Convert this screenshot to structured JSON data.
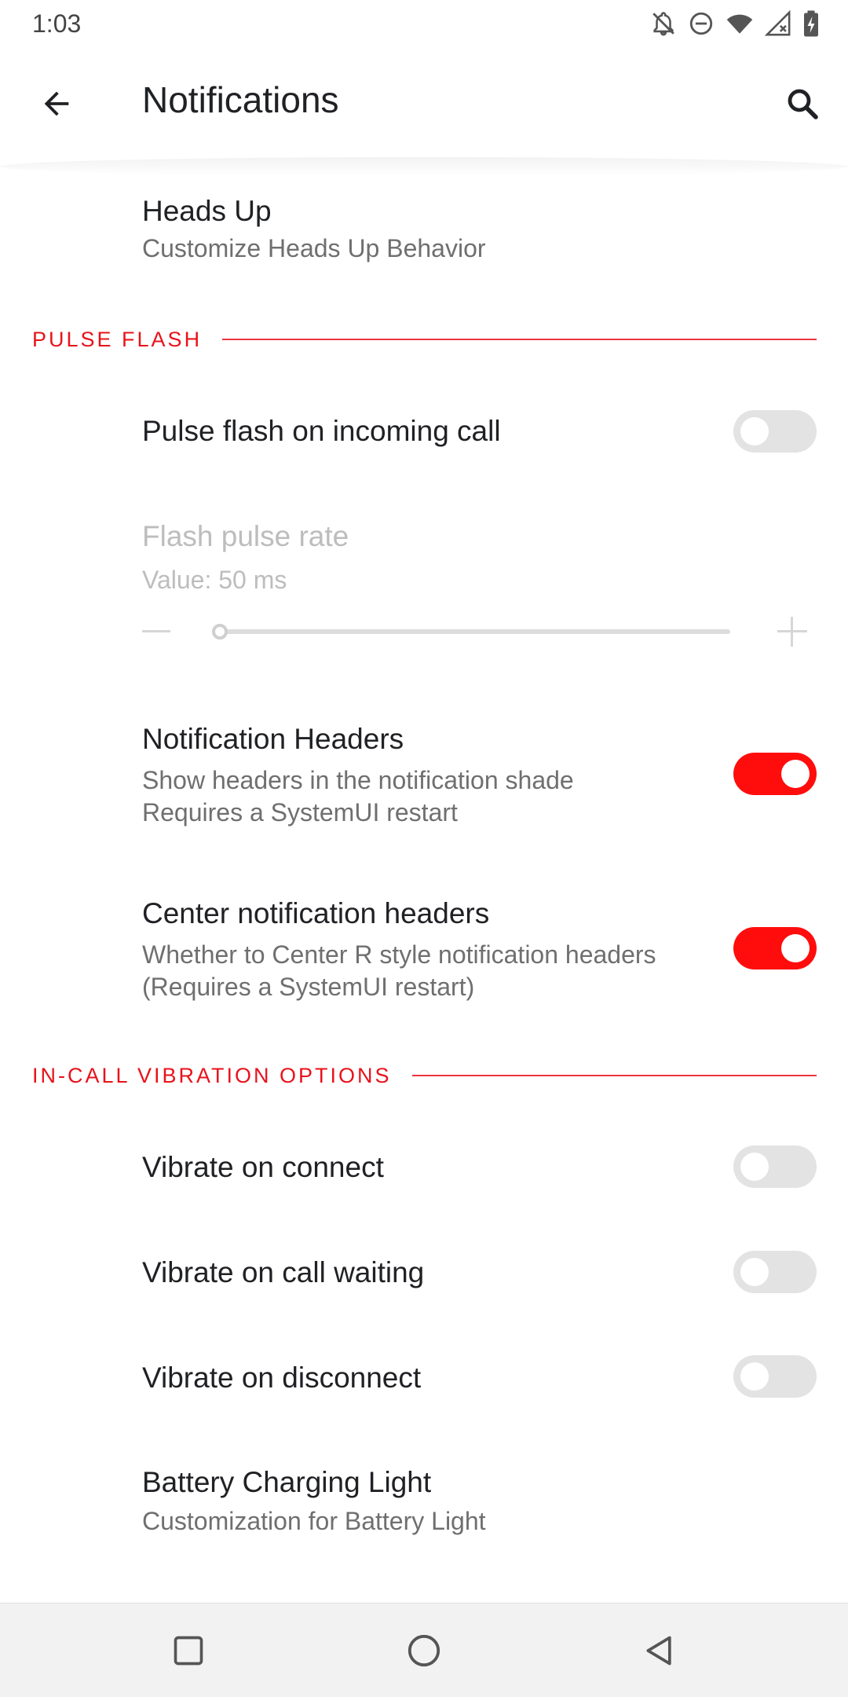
{
  "status_bar": {
    "time": "1:03",
    "icons": [
      "notifications-off-icon",
      "do-not-disturb-icon",
      "wifi-icon",
      "signal-icon",
      "battery-charging-icon"
    ]
  },
  "app_bar": {
    "title": "Notifications",
    "back_icon": "arrow-back-icon",
    "search_icon": "search-icon"
  },
  "items": {
    "heads_up": {
      "title": "Heads Up",
      "summary": "Customize Heads Up Behavior"
    },
    "pulse_section": {
      "label": "PULSE FLASH"
    },
    "pulse_call": {
      "title": "Pulse flash on incoming call",
      "checked": false
    },
    "flash_rate": {
      "title": "Flash pulse rate",
      "summary": "Value: 50 ms",
      "value_ms": 50,
      "slider_fraction": 0.0,
      "enabled": false
    },
    "notif_headers": {
      "title": "Notification Headers",
      "summary_1": "Show headers in the notification shade",
      "summary_2": "Requires a SystemUI restart",
      "checked": true
    },
    "center_headers": {
      "title": "Center notification headers",
      "summary_1": "Whether to Center R style notification headers",
      "summary_2": "(Requires a SystemUI restart)",
      "checked": true
    },
    "vibration_section": {
      "label": "IN-CALL VIBRATION OPTIONS"
    },
    "vibrate_connect": {
      "title": "Vibrate on connect",
      "checked": false
    },
    "vibrate_waiting": {
      "title": "Vibrate on call waiting",
      "checked": false
    },
    "vibrate_disconnect": {
      "title": "Vibrate on disconnect",
      "checked": false
    },
    "battery_light": {
      "title": "Battery Charging Light",
      "summary": "Customization for Battery Light"
    }
  },
  "colors": {
    "accent": "#e8131b",
    "switch_on": "#ff0d0d",
    "switch_off": "#e3e3e3"
  },
  "nav_bar": {
    "buttons": [
      "recents-square-icon",
      "home-circle-icon",
      "back-triangle-icon"
    ]
  }
}
